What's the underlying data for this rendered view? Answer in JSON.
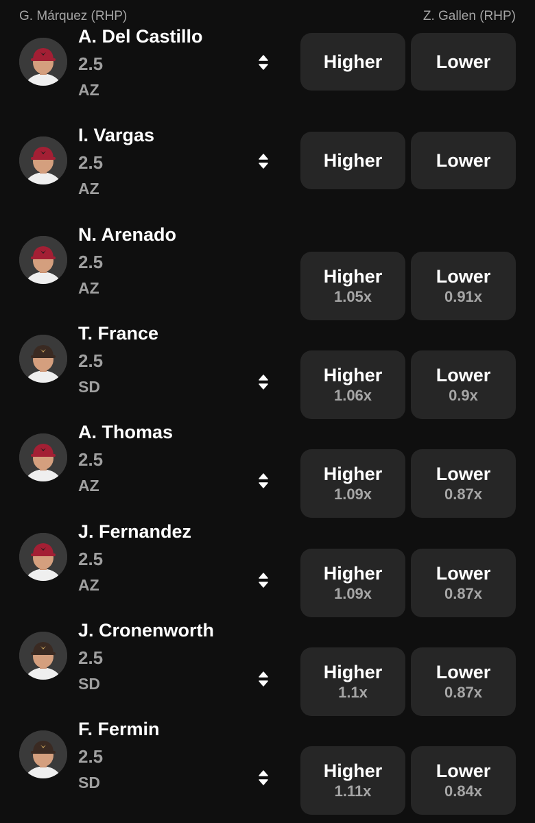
{
  "header": {
    "left_pitcher": "G. Márquez (RHP)",
    "right_pitcher": "Z. Gallen (RHP)"
  },
  "colors": {
    "background": "#0f0f0f",
    "button_bg": "#262626",
    "muted_text": "#a0a0a0",
    "az_cap": "#a31f34",
    "sd_cap": "#3a2a22"
  },
  "players": [
    {
      "name": "A. Del Castillo",
      "line": "2.5",
      "team": "AZ",
      "higher_label": "Higher",
      "lower_label": "Lower",
      "higher_mult": null,
      "lower_mult": null,
      "sort_icon": true
    },
    {
      "name": "I. Vargas",
      "line": "2.5",
      "team": "AZ",
      "higher_label": "Higher",
      "lower_label": "Lower",
      "higher_mult": null,
      "lower_mult": null,
      "sort_icon": true
    },
    {
      "name": "N. Arenado",
      "line": "2.5",
      "team": "AZ",
      "higher_label": "Higher",
      "lower_label": "Lower",
      "higher_mult": "1.05x",
      "lower_mult": "0.91x",
      "sort_icon": false
    },
    {
      "name": "T. France",
      "line": "2.5",
      "team": "SD",
      "higher_label": "Higher",
      "lower_label": "Lower",
      "higher_mult": "1.06x",
      "lower_mult": "0.9x",
      "sort_icon": true
    },
    {
      "name": "A. Thomas",
      "line": "2.5",
      "team": "AZ",
      "higher_label": "Higher",
      "lower_label": "Lower",
      "higher_mult": "1.09x",
      "lower_mult": "0.87x",
      "sort_icon": true
    },
    {
      "name": "J. Fernandez",
      "line": "2.5",
      "team": "AZ",
      "higher_label": "Higher",
      "lower_label": "Lower",
      "higher_mult": "1.09x",
      "lower_mult": "0.87x",
      "sort_icon": true
    },
    {
      "name": "J. Cronenworth",
      "line": "2.5",
      "team": "SD",
      "higher_label": "Higher",
      "lower_label": "Lower",
      "higher_mult": "1.1x",
      "lower_mult": "0.87x",
      "sort_icon": true
    },
    {
      "name": "F. Fermin",
      "line": "2.5",
      "team": "SD",
      "higher_label": "Higher",
      "lower_label": "Lower",
      "higher_mult": "1.11x",
      "lower_mult": "0.84x",
      "sort_icon": true
    }
  ]
}
